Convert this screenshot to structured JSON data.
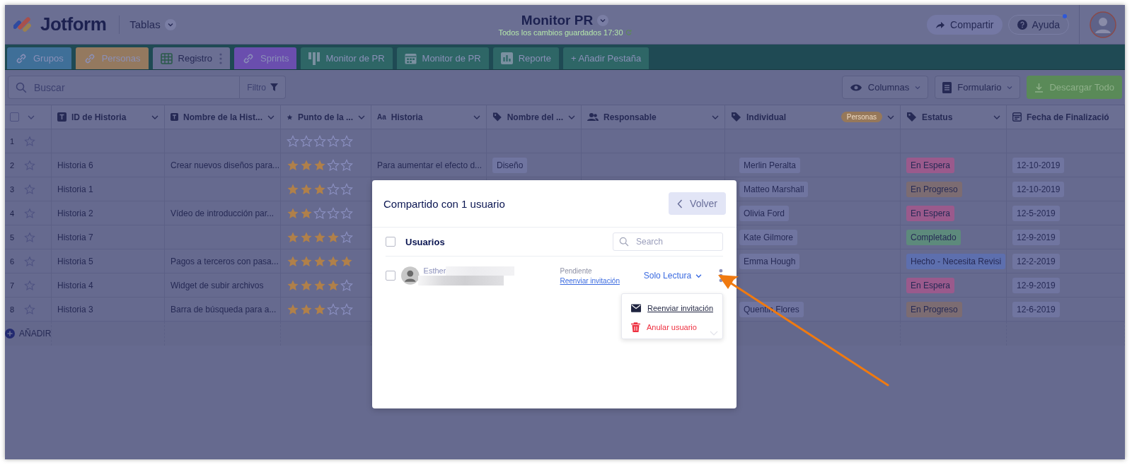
{
  "header": {
    "brand": "Jotform",
    "tables_menu": "Tablas",
    "title": "Monitor PR",
    "saved_status": "Todos los cambios guardados 17:30",
    "share_button": "Compartir",
    "help_button": "Ayuda",
    "help_notification": true
  },
  "tabs": [
    {
      "label": "Grupos",
      "kind": "link",
      "color": "#3f6f98",
      "selected": false
    },
    {
      "label": "Personas",
      "kind": "link",
      "color": "#94795f",
      "selected": false
    },
    {
      "label": "Registro",
      "kind": "grid",
      "color": "#6b6f93",
      "selected": true
    },
    {
      "label": "Sprints",
      "kind": "link",
      "color": "#6a4eae",
      "selected": false
    },
    {
      "label": "Monitor de PR",
      "kind": "kanban",
      "color": "#2e6666",
      "selected": false
    },
    {
      "label": "Monitor de PR",
      "kind": "calendar",
      "color": "#2e6666",
      "selected": false
    },
    {
      "label": "Reporte",
      "kind": "report",
      "color": "#2e6666",
      "selected": false
    },
    {
      "label": "+ Añadir Pestaña",
      "kind": "add",
      "color": "#2e6666",
      "selected": false
    }
  ],
  "toolbar": {
    "search_placeholder": "Buscar",
    "filter_button": "Filtro",
    "columns_button": "Columnas",
    "form_button": "Formulario",
    "download_button": "Descargar Todo"
  },
  "table": {
    "select_all": false,
    "columns": [
      {
        "label": "ID de Historia",
        "kind": "text"
      },
      {
        "label": "Nombre de la Hist...",
        "kind": "text"
      },
      {
        "label": "Punto de la ...",
        "kind": "star"
      },
      {
        "label": "Historia",
        "kind": "aa",
        "icon_text": "Aa"
      },
      {
        "label": "Nombre del ...",
        "kind": "tag"
      },
      {
        "label": "Responsable",
        "kind": "people"
      },
      {
        "label": "Individual",
        "kind": "tag",
        "badge": "Personas"
      },
      {
        "label": "Estatus",
        "kind": "tag"
      },
      {
        "label": "Fecha de Finalizació",
        "kind": "date"
      }
    ],
    "rows": [
      {
        "number": "1",
        "stars": 0
      },
      {
        "number": "2",
        "id": "Historia 6",
        "name": "Crear nuevos diseños para...",
        "stars": 3,
        "story": "Para aumentar el efecto d...",
        "tag": "Diseño",
        "person": "Merlin Peralta",
        "status": {
          "label": "En Espera",
          "color": "#9a5a8c"
        },
        "date": "12-10-2019"
      },
      {
        "number": "3",
        "id": "Historia 1",
        "stars": 3,
        "person": "Matteo Marshall",
        "status": {
          "label": "En Progreso",
          "color": "#7c6c72"
        },
        "date": "12-10-2019"
      },
      {
        "number": "4",
        "id": "Historia 2",
        "name": "Vídeo de introducción par...",
        "stars": 2,
        "person": "Olivia Ford",
        "status": {
          "label": "En Espera",
          "color": "#9a5a8c"
        },
        "date": "12-5-2019"
      },
      {
        "number": "5",
        "id": "Historia 7",
        "stars": 4,
        "person": "Kate Gilmore",
        "status": {
          "label": "Completado",
          "color": "#5d8a7c"
        },
        "date": "12-9-2019"
      },
      {
        "number": "6",
        "id": "Historia 5",
        "name": "Pagos a terceros con pasa...",
        "stars": 5,
        "person": "Emma Hough",
        "status": {
          "label": "Hecho - Necesita Revisi",
          "color": "#5d6fae"
        },
        "date": "12-2-2019"
      },
      {
        "number": "7",
        "id": "Historia 4",
        "name": "Widget de subir archivos",
        "stars": 4,
        "status": {
          "label": "En Espera",
          "color": "#9a5a8c"
        },
        "date": "12-9-2019"
      },
      {
        "number": "8",
        "id": "Historia 3",
        "name": "Barra de búsqueda para a...",
        "stars": 3,
        "person": "Quentin Flores",
        "status": {
          "label": "En Progreso",
          "color": "#7c6c72"
        },
        "date": "12-6-2019"
      }
    ],
    "add_button": "AÑADIR"
  },
  "modal": {
    "title": "Compartido con 1 usuario",
    "back_button": "Volver",
    "users_label": "Usuarios",
    "select_all": false,
    "search_placeholder": "Search",
    "users": [
      {
        "name": "Esther",
        "checked": false,
        "status": "Pendiente",
        "resend_link": "Reenviar invitación",
        "role": "Solo Lectura"
      }
    ],
    "menu": [
      {
        "label": "Reenviar invitación",
        "kind": "resend"
      },
      {
        "label": "Anular usuario",
        "kind": "remove"
      }
    ]
  }
}
